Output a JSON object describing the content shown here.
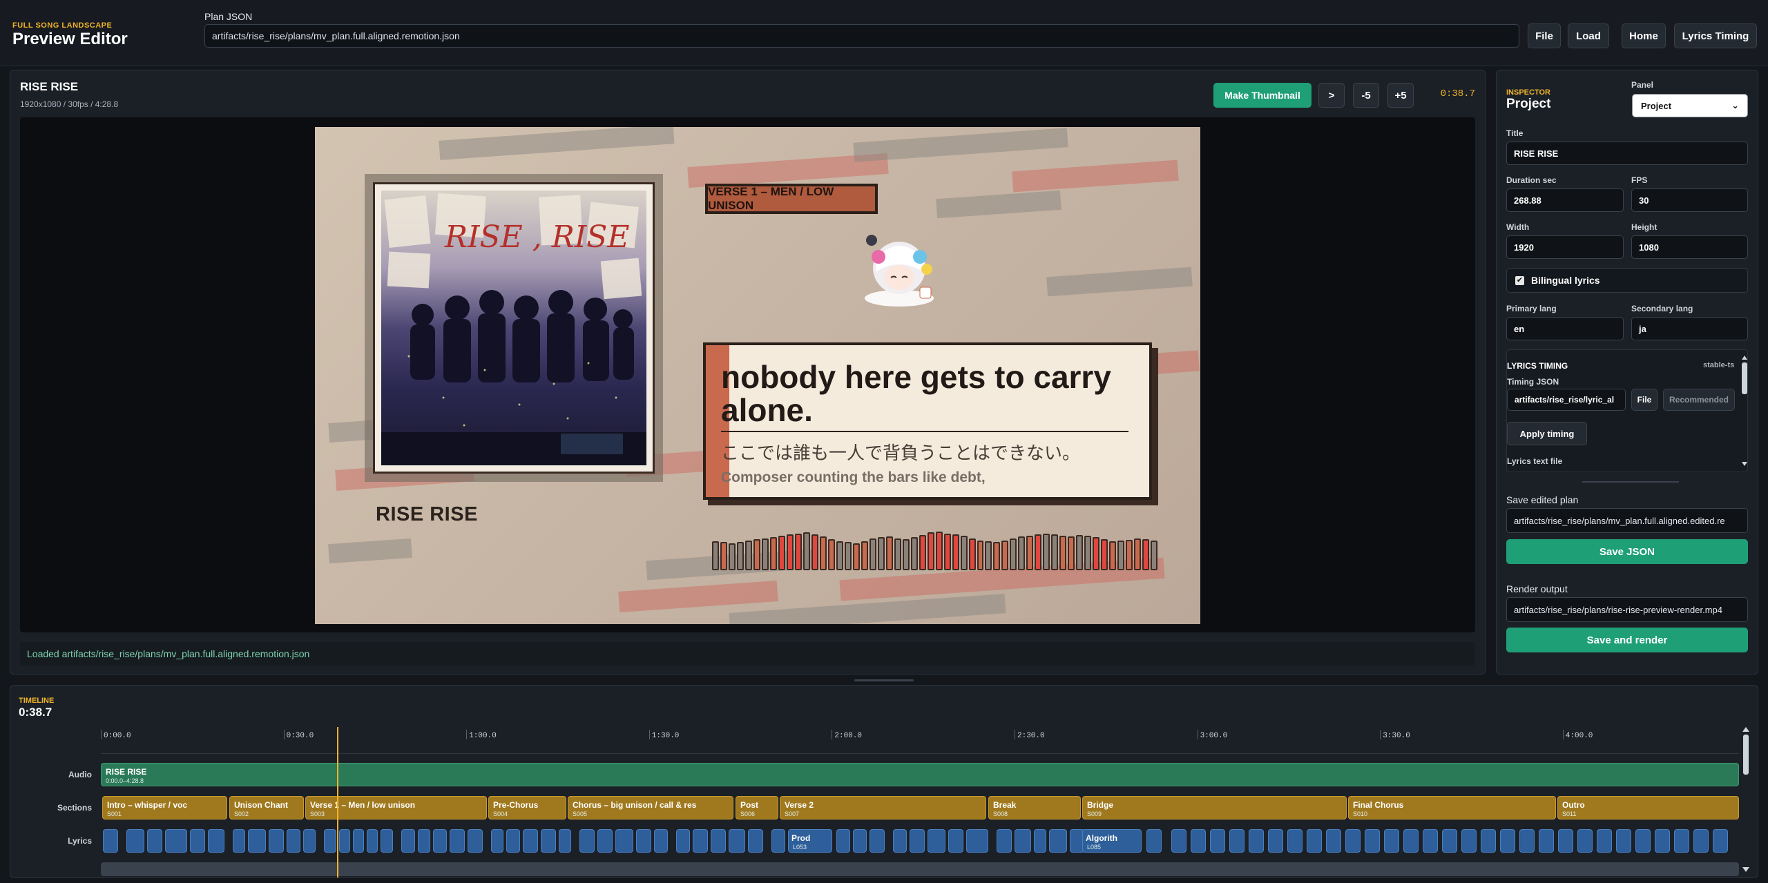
{
  "header": {
    "brand_eyebrow": "FULL SONG LANDSCAPE",
    "brand_title": "Preview Editor",
    "plan_label": "Plan JSON",
    "plan_path": "artifacts/rise_rise/plans/mv_plan.full.aligned.remotion.json",
    "buttons": {
      "file": "File",
      "load": "Load",
      "home": "Home",
      "lyrics_timing": "Lyrics Timing"
    }
  },
  "preview": {
    "title": "RISE RISE",
    "meta": "1920x1080 / 30fps / 4:28.8",
    "make_thumbnail": "Make Thumbnail",
    "play": ">",
    "minus5": "-5",
    "plus5": "+5",
    "time": "0:38.7",
    "status": "Loaded artifacts/rise_rise/plans/mv_plan.full.aligned.remotion.json",
    "frame": {
      "section_tag": "VERSE 1 – MEN / LOW UNISON",
      "artwork_title": "RISE RISE",
      "artwork_text": "RISE , RISE",
      "lyric_main": "nobody here gets to carry alone.",
      "lyric_ja": "ここでは誰も一人で背負うことはできない。",
      "lyric_next": "Composer counting the bars like debt,",
      "meter_levels": [
        0.72,
        0.7,
        0.68,
        0.7,
        0.74,
        0.78,
        0.8,
        0.82,
        0.86,
        0.9,
        0.92,
        0.94,
        0.9,
        0.84,
        0.78,
        0.72,
        0.7,
        0.68,
        0.72,
        0.8,
        0.82,
        0.84,
        0.8,
        0.78,
        0.82,
        0.88,
        0.94,
        0.96,
        0.92,
        0.9,
        0.86,
        0.8,
        0.74,
        0.72,
        0.7,
        0.74,
        0.8,
        0.84,
        0.86,
        0.9,
        0.92,
        0.9,
        0.86,
        0.84,
        0.88,
        0.86,
        0.82,
        0.78,
        0.72,
        0.74,
        0.76,
        0.8,
        0.78,
        0.74
      ],
      "meter_colors": [
        "#8a817a",
        "#c9694d",
        "#8a817a",
        "#8a817a",
        "#8a817a",
        "#c9694d",
        "#8a817a",
        "#c9694d",
        "#e0473f",
        "#e0473f",
        "#e0473f",
        "#8a817a",
        "#e0473f",
        "#c9694d",
        "#c9694d",
        "#8a817a",
        "#8a817a",
        "#c9694d",
        "#c9694d",
        "#8a817a",
        "#8a817a",
        "#c9694d",
        "#8a817a",
        "#8a817a",
        "#8a817a",
        "#e0473f",
        "#e0473f",
        "#e0473f",
        "#e0473f",
        "#e0473f",
        "#8a817a",
        "#e0473f",
        "#c9694d",
        "#8a817a",
        "#c9694d",
        "#c9694d",
        "#8a817a",
        "#8a817a",
        "#c9694d",
        "#e0473f",
        "#8a817a",
        "#8a817a",
        "#c9694d",
        "#c9694d",
        "#8a817a",
        "#8a817a",
        "#e0473f",
        "#e0473f",
        "#c9694d",
        "#8a817a",
        "#c9694d",
        "#c9694d",
        "#e0473f",
        "#8a817a"
      ]
    }
  },
  "inspector": {
    "eyebrow": "INSPECTOR",
    "title": "Project",
    "panel_label": "Panel",
    "panel_value": "Project",
    "title_label": "Title",
    "title_value": "RISE RISE",
    "duration_label": "Duration sec",
    "duration_value": "268.88",
    "fps_label": "FPS",
    "fps_value": "30",
    "width_label": "Width",
    "width_value": "1920",
    "height_label": "Height",
    "height_value": "1080",
    "bilingual_label": "Bilingual lyrics",
    "primary_lang_label": "Primary lang",
    "primary_lang_value": "en",
    "secondary_lang_label": "Secondary lang",
    "secondary_lang_value": "ja",
    "lyrics_timing": {
      "heading": "LYRICS TIMING",
      "badge": "stable-ts",
      "timing_json_label": "Timing JSON",
      "timing_json_value": "artifacts/rise_rise/lyric_al",
      "file": "File",
      "recommended": "Recommended",
      "apply": "Apply timing",
      "lyrics_text_label": "Lyrics text file"
    },
    "save_plan_label": "Save edited plan",
    "save_plan_value": "artifacts/rise_rise/plans/mv_plan.full.aligned.edited.re",
    "save_json": "Save JSON",
    "render_label": "Render output",
    "render_value": "artifacts/rise_rise/plans/rise-rise-preview-render.mp4",
    "save_render": "Save and render"
  },
  "timeline": {
    "eyebrow": "TIMELINE",
    "time": "0:38.7",
    "ticks": [
      "0:00.0",
      "0:30.0",
      "1:00.0",
      "1:30.0",
      "2:00.0",
      "2:30.0",
      "3:00.0",
      "3:30.0",
      "4:00.0"
    ],
    "rows": {
      "audio": "Audio",
      "sections": "Sections",
      "lyrics": "Lyrics"
    },
    "audio_clip": {
      "title": "RISE RISE",
      "range": "0:00.0–4:28.8"
    },
    "sections": [
      {
        "title": "Intro – whisper / voc",
        "id": "S001"
      },
      {
        "title": "Unison Chant",
        "id": "S002"
      },
      {
        "title": "Verse 1 – Men / low unison",
        "id": "S003"
      },
      {
        "title": "Pre-Chorus",
        "id": "S004"
      },
      {
        "title": "Chorus – big unison / call & res",
        "id": "S005"
      },
      {
        "title": "Post",
        "id": "S006"
      },
      {
        "title": "Verse 2",
        "id": "S007"
      },
      {
        "title": "Break",
        "id": "S008"
      },
      {
        "title": "Bridge",
        "id": "S009"
      },
      {
        "title": "Final Chorus",
        "id": "S010"
      },
      {
        "title": "Outro",
        "id": "S011"
      }
    ],
    "lyrics_named": [
      {
        "title": "Prod",
        "id": "L053"
      },
      {
        "title": "Algorith",
        "id": "L085"
      }
    ]
  }
}
